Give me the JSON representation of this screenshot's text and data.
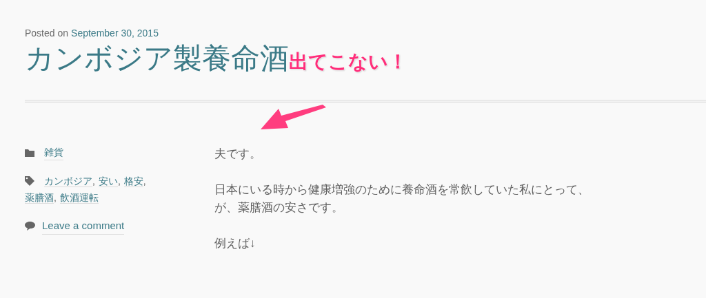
{
  "entry_meta": {
    "label": "Posted on",
    "date": "September 30, 2015"
  },
  "title": "カンボジア製養命酒",
  "annotation": {
    "text": "出てこない！"
  },
  "footer_meta": {
    "category": "雑貨",
    "tags": [
      {
        "label": "カンボジア",
        "separator": ","
      },
      {
        "label": "安い",
        "separator": ","
      },
      {
        "label": "格安",
        "separator": ","
      },
      {
        "label": "薬膳酒",
        "separator": ","
      },
      {
        "label": "飲酒運転"
      }
    ],
    "comment_link": "Leave a comment"
  },
  "content": {
    "paragraphs": [
      [
        "夫です。"
      ],
      [
        "日本にいる時から健康増強のために養命酒を常飲していた私にとって、",
        "が、薬膳酒の安さです。"
      ],
      [
        "例えば↓"
      ]
    ]
  }
}
